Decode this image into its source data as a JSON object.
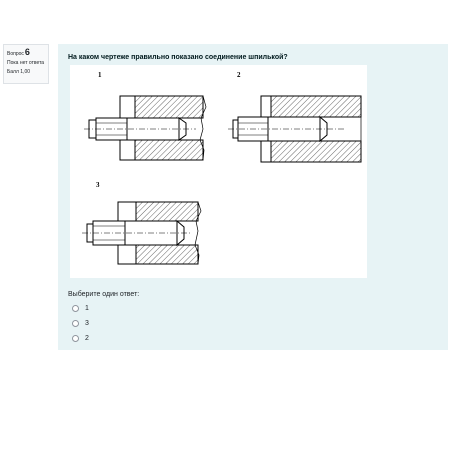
{
  "info": {
    "question_label": "Вопрос",
    "question_number": "6",
    "status": "Пока нет ответа",
    "grade": "Балл 1,00"
  },
  "question": {
    "text": "На каком чертеже правильно показано соединение шпилькой?",
    "drawing_labels": [
      "1",
      "2",
      "3"
    ],
    "prompt": "Выберите один ответ:",
    "options": [
      "1",
      "3",
      "2"
    ]
  },
  "colors": {
    "content_bg": "#e7f3f5",
    "info_bg": "#f8f9fa"
  }
}
